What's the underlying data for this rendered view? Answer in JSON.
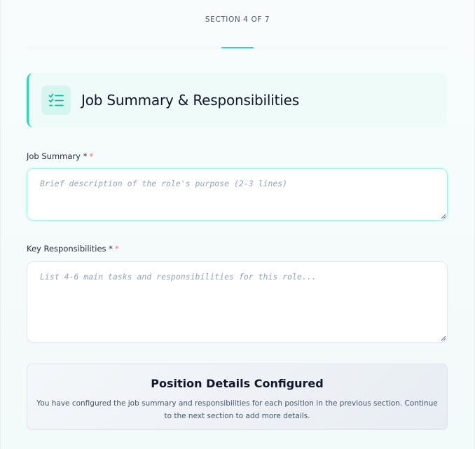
{
  "progress": {
    "label": "SECTION 4 OF 7",
    "current": 4,
    "total": 7
  },
  "section": {
    "title": "Job Summary & Responsibilities",
    "icon": "list-checks-icon",
    "accent_color": "#2dd4bf"
  },
  "fields": {
    "job_summary": {
      "label": "Job Summary",
      "required_marker": "*",
      "required_marker_red": "*",
      "value": "",
      "placeholder": "Brief description of the role's purpose (2-3 lines)"
    },
    "key_responsibilities": {
      "label": "Key Responsibilities",
      "required_marker": "*",
      "required_marker_red": "*",
      "value": "",
      "placeholder": "List 4-6 main tasks and responsibilities for this role..."
    }
  },
  "info_card": {
    "title": "Position Details Configured",
    "text": "You have configured the job summary and responsibilities for each position in the previous section. Continue to the next section to add more details."
  }
}
